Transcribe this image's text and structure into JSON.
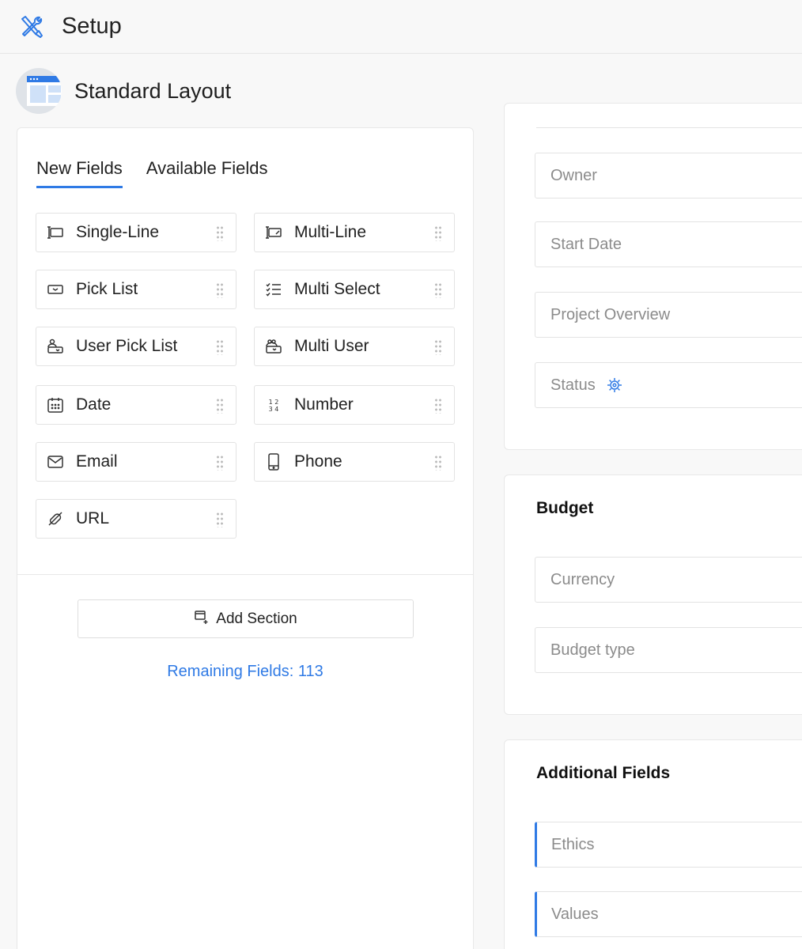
{
  "app": {
    "title": "Setup",
    "icon": "tools-icon"
  },
  "layout": {
    "name": "Standard Layout",
    "icon": "layout-icon"
  },
  "tabs": [
    {
      "label": "New Fields",
      "active": true
    },
    {
      "label": "Available Fields",
      "active": false
    }
  ],
  "fields": [
    {
      "label": "Single-Line",
      "icon": "single-line-icon"
    },
    {
      "label": "Multi-Line",
      "icon": "multi-line-icon"
    },
    {
      "label": "Pick List",
      "icon": "pick-list-icon"
    },
    {
      "label": "Multi Select",
      "icon": "multi-select-icon"
    },
    {
      "label": "User Pick List",
      "icon": "user-pick-list-icon"
    },
    {
      "label": "Multi User",
      "icon": "multi-user-icon"
    },
    {
      "label": "Date",
      "icon": "calendar-icon"
    },
    {
      "label": "Number",
      "icon": "number-icon"
    },
    {
      "label": "Email",
      "icon": "envelope-icon"
    },
    {
      "label": "Phone",
      "icon": "phone-icon"
    },
    {
      "label": "URL",
      "icon": "link-icon"
    }
  ],
  "add_section": {
    "label": "Add Section",
    "icon": "add-section-icon"
  },
  "remaining": "Remaining Fields: 113",
  "sections": {
    "top": {
      "fields": [
        "Owner",
        "Start Date",
        "Project Overview",
        "Status"
      ]
    },
    "budget": {
      "title": "Budget",
      "fields": [
        "Currency",
        "Budget type"
      ]
    },
    "additional": {
      "title": "Additional Fields",
      "fields": [
        "Ethics",
        "Values"
      ]
    }
  },
  "colors": {
    "accent": "#2f7ae5",
    "background": "#f8f8f8",
    "panel": "#ffffff",
    "border": "#e3e3e3",
    "placeholder": "#8b8b8b"
  }
}
